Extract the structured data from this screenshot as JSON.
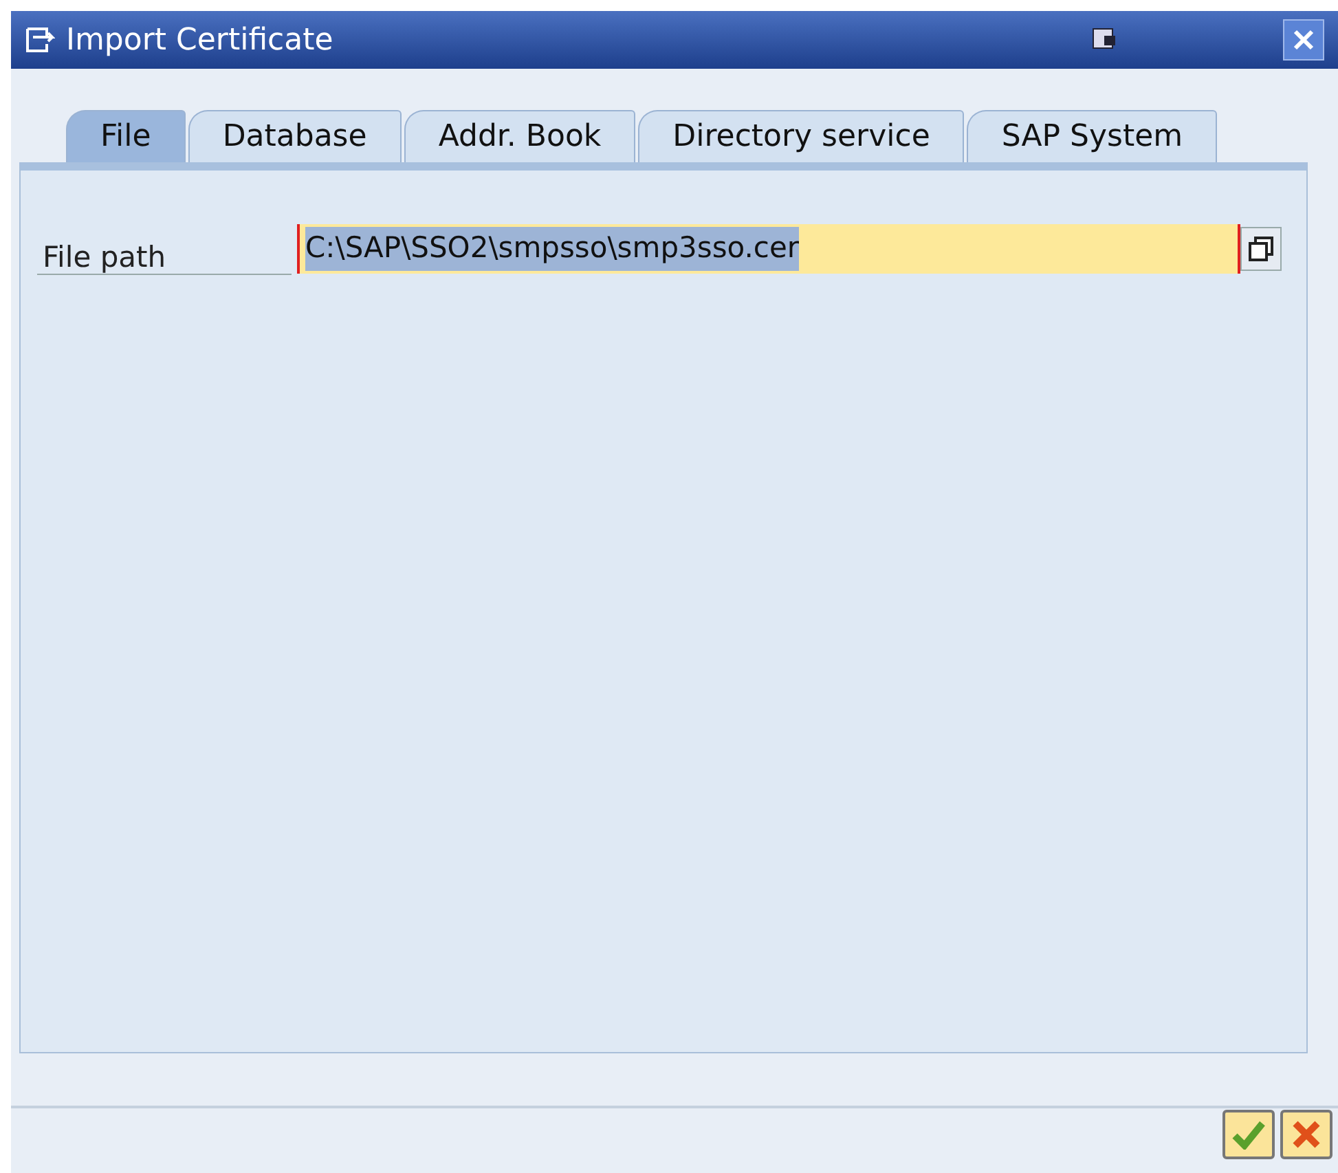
{
  "window": {
    "title": "Import Certificate"
  },
  "tabs": [
    {
      "label": "File",
      "selected": true
    },
    {
      "label": "Database",
      "selected": false
    },
    {
      "label": "Addr. Book",
      "selected": false
    },
    {
      "label": "Directory service",
      "selected": false
    },
    {
      "label": "SAP System",
      "selected": false
    }
  ],
  "file_path": {
    "label": "File path",
    "value": "C:\\SAP\\SSO2\\smpsso\\smp3sso.cer"
  }
}
